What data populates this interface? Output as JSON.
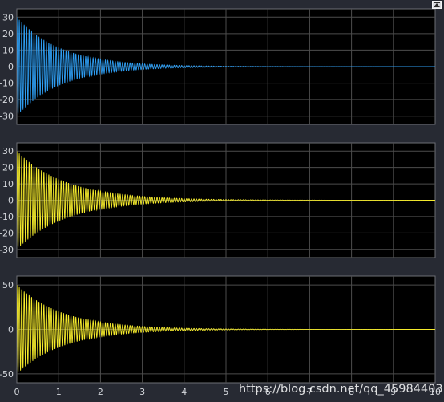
{
  "chart_data": [
    {
      "type": "line",
      "title": "",
      "xlabel": "",
      "ylabel": "",
      "xlim": [
        0,
        10
      ],
      "ylim": [
        -35,
        35
      ],
      "yticks": [
        -30,
        -20,
        -10,
        0,
        10,
        20,
        30
      ],
      "grid": true,
      "series": [
        {
          "color": "#2e9cf0",
          "amplitude": 30,
          "decay_rate": 0.95,
          "frequency_hz": 17,
          "description_points": {
            "x": [
              0,
              1,
              2,
              3,
              4,
              5,
              6,
              7,
              8,
              9,
              10
            ],
            "y_envelope": [
              30,
              11.6,
              4.5,
              1.7,
              0.7,
              0.3,
              0.1,
              0.04,
              0.02,
              0.01,
              0
            ]
          }
        }
      ]
    },
    {
      "type": "line",
      "title": "",
      "xlabel": "",
      "ylabel": "",
      "xlim": [
        0,
        10
      ],
      "ylim": [
        -35,
        35
      ],
      "yticks": [
        -30,
        -20,
        -10,
        0,
        10,
        20,
        30
      ],
      "grid": true,
      "series": [
        {
          "color": "#f5eb2c",
          "amplitude": 30,
          "decay_rate": 0.85,
          "frequency_hz": 17,
          "description_points": {
            "x": [
              0,
              1,
              2,
              3,
              4,
              5,
              6,
              7,
              8,
              9,
              10
            ],
            "y_envelope": [
              30,
              12.8,
              5.5,
              2.3,
              1.0,
              0.4,
              0.2,
              0.08,
              0.03,
              0.01,
              0
            ]
          }
        }
      ]
    },
    {
      "type": "line",
      "title": "",
      "xlabel": "",
      "ylabel": "",
      "xlim": [
        0,
        10
      ],
      "ylim": [
        -60,
        60
      ],
      "yticks": [
        -50,
        0,
        50
      ],
      "xticks": [
        0,
        1,
        2,
        3,
        4,
        5,
        6,
        7,
        8,
        9,
        10
      ],
      "grid": true,
      "series": [
        {
          "color": "#f5eb2c",
          "amplitude": 50,
          "decay_rate": 0.9,
          "frequency_hz": 17,
          "description_points": {
            "x": [
              0,
              1,
              2,
              3,
              4,
              5,
              6,
              7,
              8,
              9,
              10
            ],
            "y_envelope": [
              50,
              20.3,
              8.3,
              3.4,
              1.4,
              0.6,
              0.2,
              0.09,
              0.04,
              0.02,
              0
            ]
          }
        }
      ]
    }
  ],
  "watermark": "https://blog.csdn.net/qq_45984403",
  "colors": {
    "figure_bg": "#272a33",
    "axes_bg": "#000000",
    "grid": "#4d4d4d",
    "tick_text": "#d6d9de"
  },
  "restore_icon": "restore-axes-icon"
}
